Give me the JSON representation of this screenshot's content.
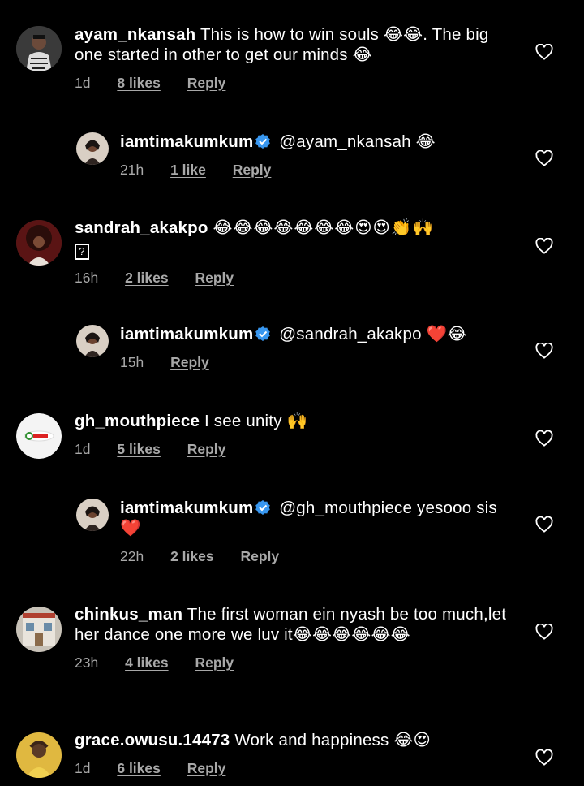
{
  "colors": {
    "background": "#000000",
    "text": "#ffffff",
    "meta": "#a8a8a8",
    "verified": "#3897f0"
  },
  "comments": [
    {
      "username": "ayam_nkansah",
      "text": "This is how to win souls 😂😂. The big one started in other to get our minds 😂",
      "time": "1d",
      "likes": "8 likes",
      "reply": "Reply",
      "verified": false,
      "is_reply": false
    },
    {
      "username": "iamtimakumkum",
      "text": "@ayam_nkansah 😂",
      "time": "21h",
      "likes": "1 like",
      "reply": "Reply",
      "verified": true,
      "is_reply": true
    },
    {
      "username": "sandrah_akakpo",
      "text": "😂😂😂😂😂😂😂😍😍👏🙌",
      "text_extra": "?",
      "time": "16h",
      "likes": "2 likes",
      "reply": "Reply",
      "verified": false,
      "is_reply": false
    },
    {
      "username": "iamtimakumkum",
      "text": "@sandrah_akakpo ❤️😂",
      "time": "15h",
      "likes": "",
      "reply": "Reply",
      "verified": true,
      "is_reply": true
    },
    {
      "username": "gh_mouthpiece",
      "text": "I see unity 🙌",
      "time": "1d",
      "likes": "5 likes",
      "reply": "Reply",
      "verified": false,
      "is_reply": false
    },
    {
      "username": "iamtimakumkum",
      "text": "@gh_mouthpiece yesooo sis ❤️",
      "time": "22h",
      "likes": "2 likes",
      "reply": "Reply",
      "verified": true,
      "is_reply": true
    },
    {
      "username": "chinkus_man",
      "text": "The first woman ein nyash be too much,let her dance one more we luv it😂😂😂😂😂😂",
      "time": "23h",
      "likes": "4 likes",
      "reply": "Reply",
      "verified": false,
      "is_reply": false
    },
    {
      "username": "grace.owusu.14473",
      "text": "Work and happiness 😂😍",
      "time": "1d",
      "likes": "6 likes",
      "reply": "Reply",
      "verified": false,
      "is_reply": false
    }
  ]
}
